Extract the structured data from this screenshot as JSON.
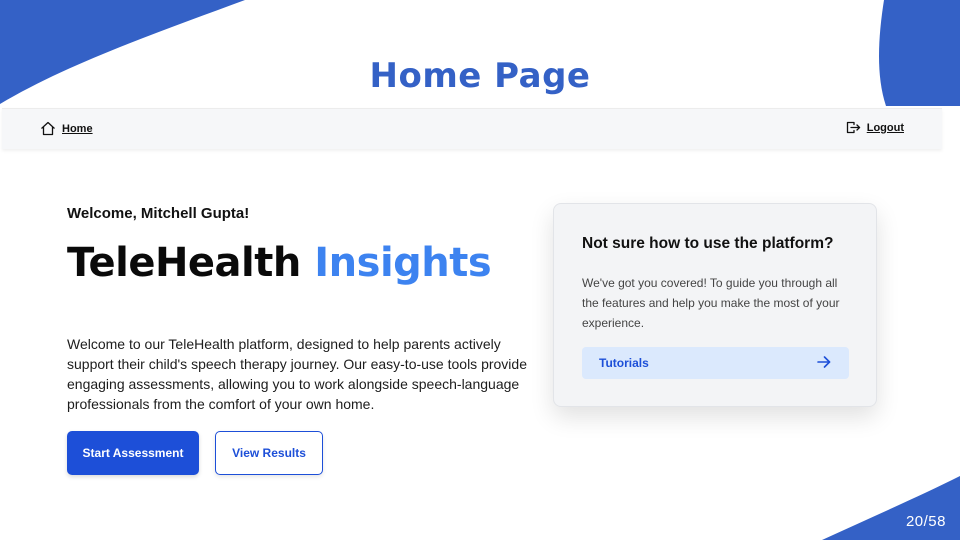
{
  "page": {
    "title": "Home Page",
    "page_number": "20/58"
  },
  "nav": {
    "home_label": "Home",
    "logout_label": "Logout"
  },
  "main": {
    "welcome": "Welcome, Mitchell Gupta!",
    "hero_title_part1": "TeleHealth",
    "hero_title_part2": "Insights",
    "intro": "Welcome to our TeleHealth platform, designed to help parents actively support their child's speech therapy journey. Our easy-to-use tools provide engaging assessments, allowing you to work alongside speech-language professionals from the comfort of your own home.",
    "start_button": "Start Assessment",
    "results_button": "View Results"
  },
  "help_card": {
    "title": "Not sure how to use the platform?",
    "text": "We've got you covered! To guide you through all the features and help you make the most of your experience.",
    "button": "Tutorials"
  },
  "colors": {
    "brand_blue": "#3461c6",
    "accent_blue": "#3d83f0",
    "button_blue": "#1d4fd8",
    "tutorial_bg": "#dbe9fd"
  },
  "icons": {
    "home": "home-icon",
    "logout": "logout-icon",
    "arrow": "arrow-right-icon"
  }
}
